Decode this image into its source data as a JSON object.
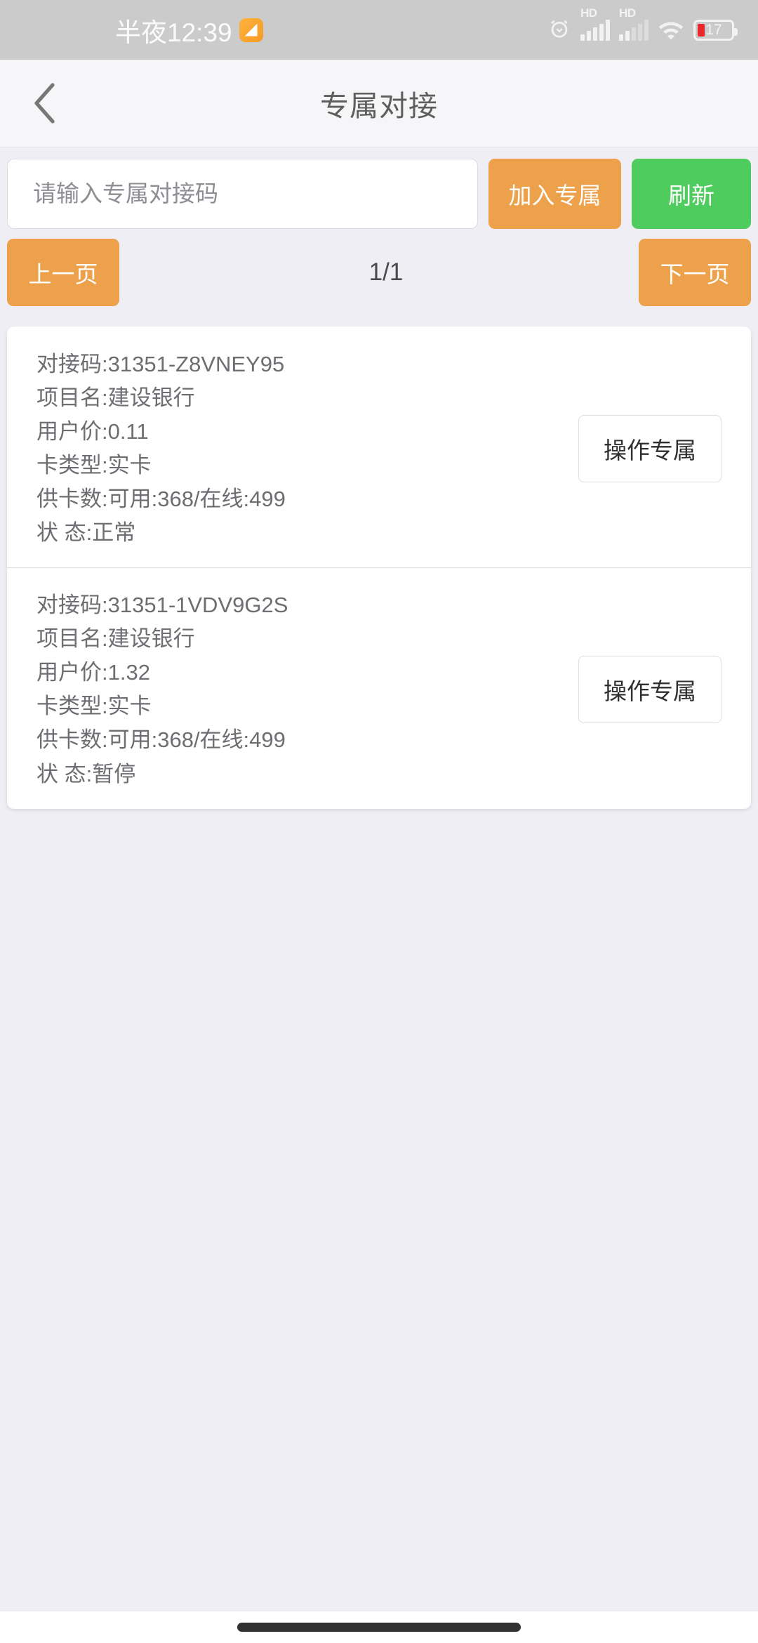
{
  "status_bar": {
    "time": "半夜12:39",
    "badge_icon": "app-badge-icon",
    "alarm_icon": "alarm-clock-icon",
    "hd_label_1": "HD",
    "hd_label_2": "HD",
    "signal_icon_1": "signal-bars-icon",
    "signal_icon_2": "signal-bars-weak-icon",
    "wifi_icon": "wifi-icon",
    "battery_icon": "battery-icon",
    "battery_percent": "17"
  },
  "header": {
    "back_icon": "back-chevron-icon",
    "title": "专属对接"
  },
  "search": {
    "placeholder": "请输入专属对接码",
    "value": "",
    "join_label": "加入专属",
    "refresh_label": "刷新"
  },
  "pager": {
    "prev_label": "上一页",
    "count": "1/1",
    "next_label": "下一页"
  },
  "cards": [
    {
      "code": "对接码:31351-Z8VNEY95",
      "project": "项目名:建设银行",
      "price": "用户价:0.11",
      "card_type": "卡类型:实卡",
      "supply": "供卡数:可用:368/在线:499",
      "status": "状 态:正常",
      "action_label": "操作专属"
    },
    {
      "code": "对接码:31351-1VDV9G2S",
      "project": "项目名:建设银行",
      "price": "用户价:1.32",
      "card_type": "卡类型:实卡",
      "supply": "供卡数:可用:368/在线:499",
      "status": "状 态:暂停",
      "action_label": "操作专属"
    }
  ],
  "colors": {
    "orange": "#eda14a",
    "green": "#4ecc5e",
    "page_bg": "#eeeef4",
    "battery_red": "#e8262b"
  },
  "nav_bar": {
    "gesture_pill": "home-gesture-pill"
  }
}
